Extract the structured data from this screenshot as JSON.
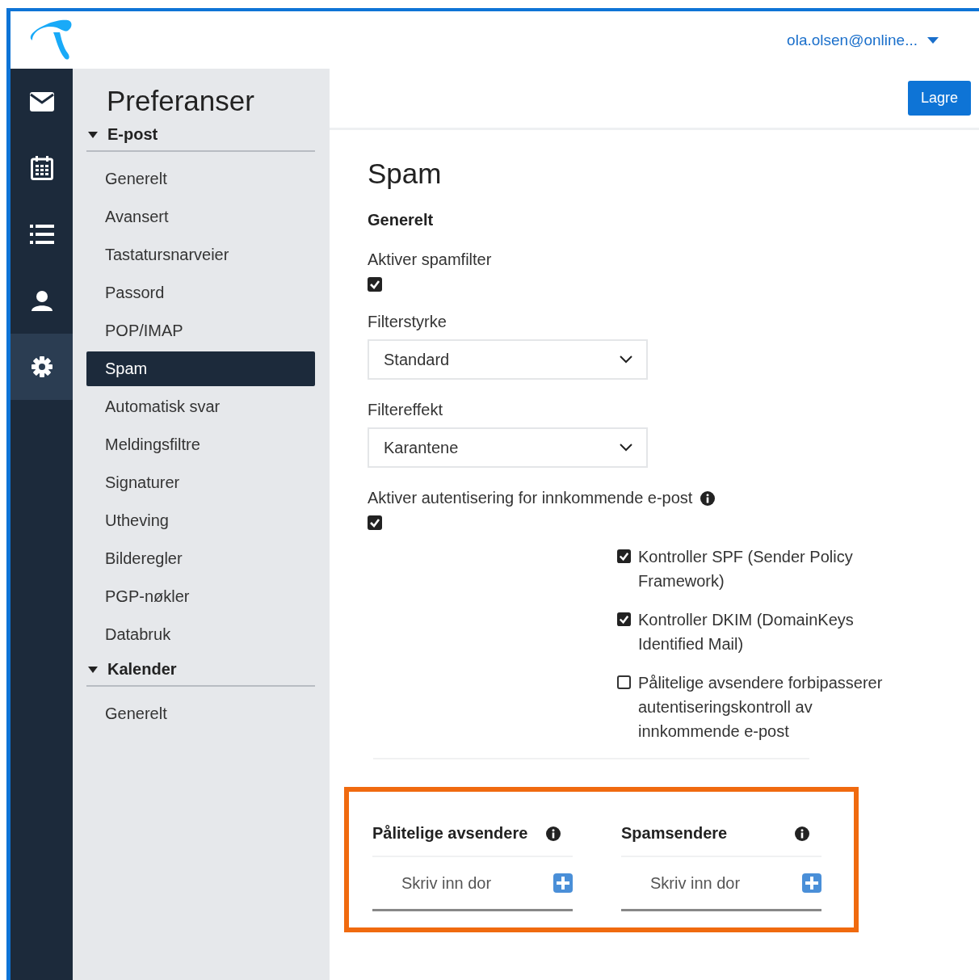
{
  "header": {
    "user": "ola.olsen@online..."
  },
  "rail": [
    {
      "kind": "mail",
      "selected": false
    },
    {
      "kind": "calendar",
      "selected": false
    },
    {
      "kind": "list",
      "selected": false
    },
    {
      "kind": "person",
      "selected": false
    },
    {
      "kind": "settings",
      "selected": true
    }
  ],
  "nav": {
    "title": "Preferanser",
    "groups": [
      {
        "label": "E-post",
        "expanded": true,
        "items": [
          {
            "label": "Generelt",
            "selected": false
          },
          {
            "label": "Avansert",
            "selected": false
          },
          {
            "label": "Tastatursnarveier",
            "selected": false
          },
          {
            "label": "Passord",
            "selected": false
          },
          {
            "label": "POP/IMAP",
            "selected": false
          },
          {
            "label": "Spam",
            "selected": true
          },
          {
            "label": "Automatisk svar",
            "selected": false
          },
          {
            "label": "Meldingsfiltre",
            "selected": false
          },
          {
            "label": "Signaturer",
            "selected": false
          },
          {
            "label": "Utheving",
            "selected": false
          },
          {
            "label": "Bilderegler",
            "selected": false
          },
          {
            "label": "PGP-nøkler",
            "selected": false
          },
          {
            "label": "Databruk",
            "selected": false
          }
        ]
      },
      {
        "label": "Kalender",
        "expanded": true,
        "items": [
          {
            "label": "Generelt",
            "selected": false
          }
        ]
      }
    ]
  },
  "save_button": "Lagre",
  "content": {
    "title": "Spam",
    "section": "Generelt",
    "fields": [
      {
        "kind": "checkbox",
        "label": "Aktiver spamfilter",
        "checked": true
      },
      {
        "kind": "select",
        "label": "Filterstyrke",
        "value": "Standard"
      },
      {
        "kind": "select",
        "label": "Filtereffekt",
        "value": "Karantene"
      },
      {
        "kind": "checkbox",
        "label": "Aktiver autentisering for innkommende e-post",
        "checked": true,
        "info": true
      }
    ],
    "sub_options": [
      {
        "label": "Kontroller SPF (Sender Policy Framework)",
        "checked": true
      },
      {
        "label": "Kontroller DKIM (DomainKeys Identified Mail)",
        "checked": true
      },
      {
        "label": "Pålitelige avsendere forbipasserer autentiseringskontroll av innkommende e-post",
        "checked": false
      }
    ],
    "lists": {
      "highlighted": true,
      "items": [
        {
          "title": "Pålitelige avsendere",
          "info": true,
          "placeholder": "Skriv inn dor"
        },
        {
          "title": "Spamsendere",
          "info": true,
          "placeholder": "Skriv inn dor"
        }
      ]
    }
  }
}
